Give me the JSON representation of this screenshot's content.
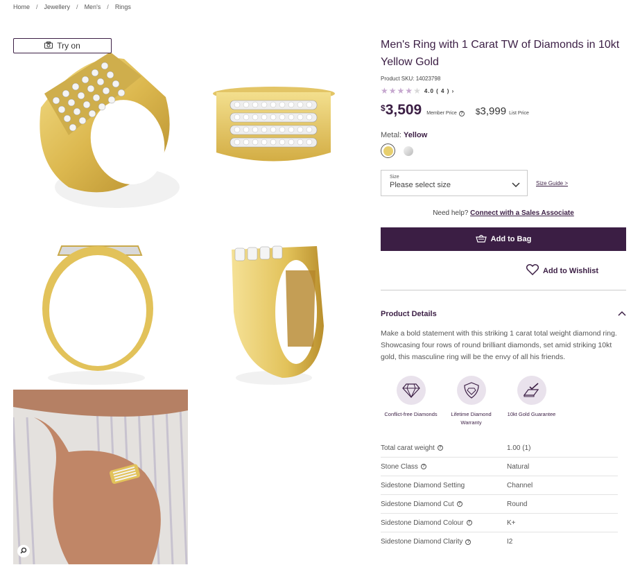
{
  "breadcrumb": [
    "Home",
    "Jewellery",
    "Men's",
    "Rings"
  ],
  "breadcrumb_separator": "/",
  "gallery": {
    "try_on_label": "Try on"
  },
  "product": {
    "title": "Men's Ring with 1 Carat TW of Diamonds in 10kt Yellow Gold",
    "sku": "Product SKU: 14023798",
    "rating": 4.0,
    "rating_text": "4.0 ( 4 ) ›",
    "price_currency": "$",
    "price_member": "3,509",
    "price_member_label": "Member Price",
    "price_list": "3,999",
    "price_list_label": "List Price",
    "metal_label": "Metal:",
    "metal_value": "Yellow",
    "swatches": [
      {
        "name": "Yellow",
        "color": "#e7cf6e"
      },
      {
        "name": "White",
        "color": "#d6d6d6"
      }
    ],
    "size_label": "Size",
    "size_placeholder": "Please select size",
    "size_guide": "Size Guide >",
    "help_text": "Need help?",
    "help_link": "Connect with a Sales Associate",
    "add_to_bag": "Add to Bag",
    "wishlist": "Add to Wishlist"
  },
  "details": {
    "heading": "Product Details",
    "description": "Make a bold statement with this striking 1 carat total weight diamond ring. Showcasing four rows of round brilliant diamonds, set amid striking 10kt gold, this masculine ring will be the envy of all his friends.",
    "features": [
      {
        "icon": "diamond-icon",
        "label": "Conflict-free Diamonds"
      },
      {
        "icon": "shield-diamond-icon",
        "label": "Lifetime Diamond Warranty"
      },
      {
        "icon": "gold-bar-check-icon",
        "label": "10kt Gold Guarantee"
      }
    ],
    "specs": [
      {
        "key": "Total carat weight",
        "info": true,
        "value": "1.00 (1)"
      },
      {
        "key": "Stone Class",
        "info": true,
        "value": "Natural"
      },
      {
        "key": "Sidestone Diamond Setting",
        "info": false,
        "value": "Channel"
      },
      {
        "key": "Sidestone Diamond Cut",
        "info": true,
        "value": "Round"
      },
      {
        "key": "Sidestone Diamond Colour",
        "info": true,
        "value": "K+"
      },
      {
        "key": "Sidestone Diamond Clarity",
        "info": true,
        "value": "I2"
      }
    ]
  },
  "colors": {
    "brand": "#3b1e44",
    "gold": "#e2c25a",
    "star": "#c6a8cf"
  }
}
